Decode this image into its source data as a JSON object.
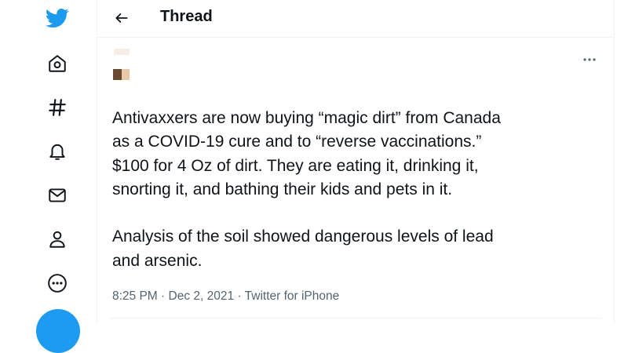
{
  "colors": {
    "brand": "#1d9bf0",
    "text": "#0f1419",
    "muted": "#536471",
    "border": "#eff3f4"
  },
  "sidebar": {
    "logo_icon": "twitter-bird-icon",
    "items": [
      {
        "icon": "home-icon"
      },
      {
        "icon": "hashtag-icon"
      },
      {
        "icon": "bell-icon"
      },
      {
        "icon": "mail-icon"
      },
      {
        "icon": "profile-icon"
      },
      {
        "icon": "more-circle-icon"
      }
    ],
    "compose_icon": "compose-tweet-icon"
  },
  "header": {
    "back_icon": "arrow-left-icon",
    "title": "Thread"
  },
  "tweet": {
    "more_icon": "more-dots-icon",
    "text": "Antivaxxers are now buying “magic dirt” from Canada\nas a COVID-19 cure and to “reverse vaccinations.”\n$100 for 4 Oz of dirt. They are eating it, drinking it,\nsnorting it, and bathing their kids and pets in it.\n\nAnalysis of the soil showed dangerous levels of lead\nand arsenic.",
    "time": "8:25 PM",
    "date": "Dec 2, 2021",
    "source": "Twitter for iPhone",
    "separator": "·"
  }
}
